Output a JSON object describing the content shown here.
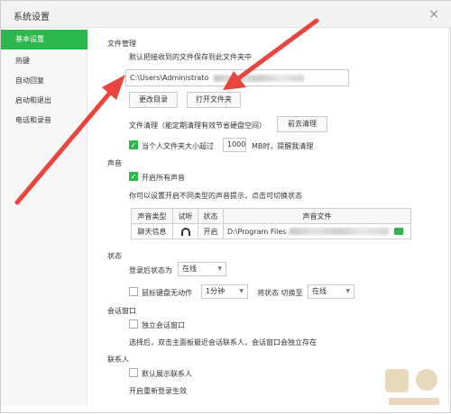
{
  "window": {
    "title": "系统设置",
    "close_glyph": "×"
  },
  "sidebar": {
    "items": [
      {
        "label": "基本设置",
        "active": true
      },
      {
        "label": "热键"
      },
      {
        "label": "自动回复"
      },
      {
        "label": "启动和退出"
      },
      {
        "label": "电话和录音"
      }
    ]
  },
  "file_mgmt": {
    "heading": "文件管理",
    "desc": "默认把接收到的文件保存到此文件夹中",
    "path_value": "C:\\Users\\Administrato",
    "change_dir": "更改目录",
    "open_folder": "打开文件夹",
    "cleanup_label": "文件清理（能定期清理有效节省硬盘空间）",
    "cleanup_button": "前去清理",
    "size_check_label": "当个人文件夹大小超过",
    "size_value": "1000",
    "size_suffix": "MB时，提醒我清理"
  },
  "sound": {
    "heading": "声音",
    "enable_all": "开启所有声音",
    "hint": "你可以设置开启不同类型的声音提示，点击可切换状态",
    "table": {
      "headers": [
        "声音类型",
        "试听",
        "状态",
        "声音文件"
      ],
      "row": {
        "type": "聊天信息",
        "status": "开启",
        "file": "D:\\Program Files"
      }
    }
  },
  "status": {
    "heading": "状态",
    "after_login_label": "登录后状态为",
    "after_login_value": "在线",
    "idle_label": "鼠标键盘无动作",
    "idle_value": "1分钟",
    "switch_label": "将状态 切换至",
    "switch_value": "在线"
  },
  "chat_window": {
    "heading": "会话窗口",
    "independent": "独立会话窗口",
    "desc": "选择后，双击主面板最近会话联系人，会话窗口会独立存在"
  },
  "contacts": {
    "heading": "联系人",
    "show_default": "默认展示联系人",
    "desc": "开启重新登录生效"
  },
  "icons": {
    "close": "close-icon",
    "headphone": "headphone-icon",
    "folder": "folder-icon",
    "arrow": "red-arrow-icon"
  },
  "colors": {
    "accent": "#2db84d",
    "arrow": "#e8453c"
  }
}
